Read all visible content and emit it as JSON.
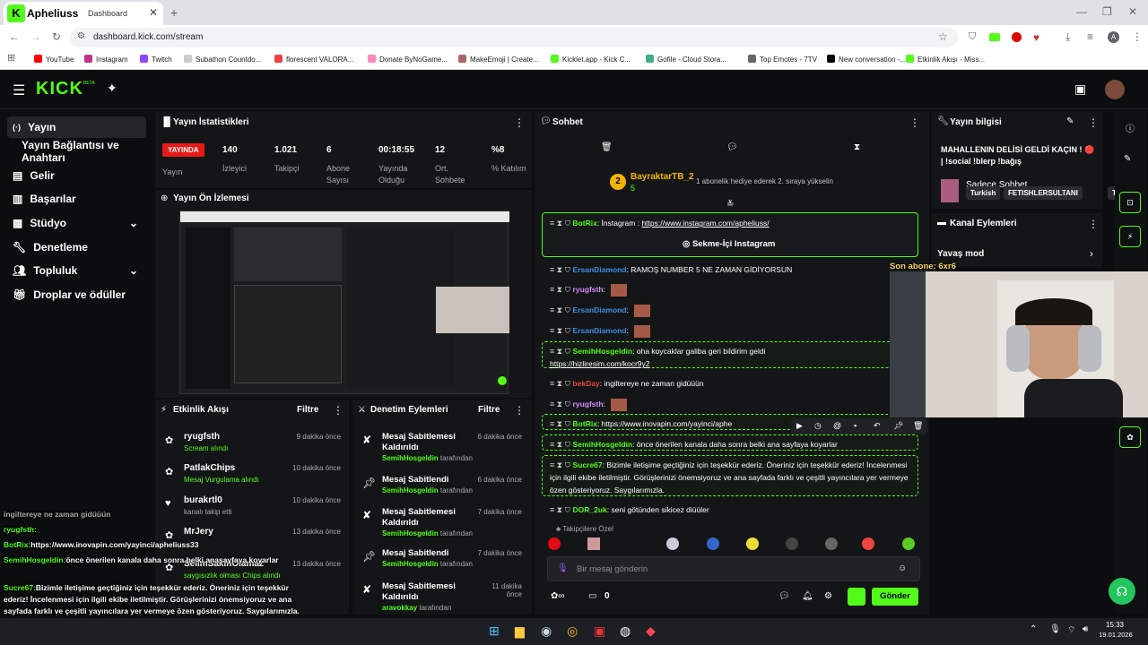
{
  "browser": {
    "tab_title": "Apheliuss",
    "tab_suffix": "Dashboard",
    "url": "dashboard.kick.com/stream",
    "bookmarks": [
      "YouTube",
      "Instagram",
      "Twitch",
      "Subathon Countdo...",
      "florescent VALORA...",
      "Donate ByNoGame...",
      "MakeEmoji | Create...",
      "Kicklet.app - Kick C...",
      "Gofile - Cloud Stora...",
      "Top Emotes - 7TV",
      "New conversation -...",
      "Etkinlik Akışı - Miss..."
    ]
  },
  "kick": {
    "logo": "KICK",
    "beta": "BETA"
  },
  "sidebar": {
    "items": [
      "Yayın",
      "Yayın Bağlantısı ve Anahtarı",
      "Gelir",
      "Başarılar",
      "Stüdyo",
      "Denetleme",
      "Topluluk",
      "Droplar ve ödüller"
    ]
  },
  "stats": {
    "title": "Yayın İstatistikleri",
    "live": "YAYINDA",
    "live_label": "Yayın",
    "cells": [
      {
        "v": "140",
        "l": "İzleyici"
      },
      {
        "v": "1.021",
        "l": "Takipçi"
      },
      {
        "v": "6",
        "l": "Abone Sayısı"
      },
      {
        "v": "00:18:55",
        "l": "Yayında Olduğu"
      },
      {
        "v": "12",
        "l": "Ort. Sohbete"
      },
      {
        "v": "%8",
        "l": "% Katılım"
      }
    ]
  },
  "preview": {
    "title": "Yayın Ön İzlemesi"
  },
  "events": {
    "title": "Etkinlik Akışı",
    "filter": "Filtre",
    "items": [
      {
        "n": "ryugfsth",
        "s": "Scream alındı",
        "t": "9 dakika önce"
      },
      {
        "n": "PatlakChips",
        "s": "Mesaj Vurgulama alındı",
        "t": "10 dakika önce"
      },
      {
        "n": "burakrtl0",
        "s": "kanalı takip etti",
        "t": "10 dakika önce"
      },
      {
        "n": "MrJery",
        "s": "",
        "t": "13 dakika önce"
      },
      {
        "n": "SelimSakinOlamaz",
        "s": "saygısızlık olması Chips alındı",
        "t": "13 dakika önce"
      }
    ]
  },
  "mod": {
    "title": "Denetim Eylemleri",
    "filter": "Filtre",
    "items": [
      {
        "a": "Mesaj Sabitlemesi Kaldırıldı",
        "b": "SemihHosgeldin",
        "t": "6 dakika önce"
      },
      {
        "a": "Mesaj Sabitlendi",
        "b": "SemihHosgeldin",
        "t": "6 dakika önce"
      },
      {
        "a": "Mesaj Sabitlemesi Kaldırıldı",
        "b": "SemihHosgeldin",
        "t": "7 dakika önce"
      },
      {
        "a": "Mesaj Sabitlendi",
        "b": "SemihHosgeldin",
        "t": "7 dakika önce"
      },
      {
        "a": "Mesaj Sabitlemesi Kaldırıldı",
        "b": "aravokkay",
        "t": "11 dakika önce"
      }
    ],
    "by": "tarafından"
  },
  "chat": {
    "title": "Sohbet",
    "gift_user": "BayraktarTB_2",
    "gift_count": "5",
    "gift_text": "1 abonelik hediye ederek 2. sıraya yükselin",
    "pinned_user": "BotRix",
    "pinned_text": "İnstagram : ",
    "pinned_link": "https://www.instagram.com/apheliuss/",
    "pinned_btn": "Sekme-İçi Instagram",
    "messages": [
      {
        "u": "ErsanDiamond",
        "c": "#3a8ee6",
        "t": "RAMOŞ NUMBER 5 NE ZAMAN GİDİYORSUN"
      },
      {
        "u": "ryugfsth",
        "c": "#d58cff",
        "t": ""
      },
      {
        "u": "ErsanDiamond",
        "c": "#3a8ee6",
        "t": ""
      },
      {
        "u": "ErsanDiamond",
        "c": "#3a8ee6",
        "t": ""
      },
      {
        "u": "SemihHosgeldin",
        "c": "#53fc18",
        "t": "oha koycaklar galiba geri bildirim geldi"
      },
      {
        "u": "bekDay",
        "c": "#e0453c",
        "t": "ingiltereye ne zaman gidüüün"
      },
      {
        "u": "ryugfsth",
        "c": "#d58cff",
        "t": ""
      },
      {
        "u": "BotRix",
        "c": "#53fc18",
        "t": "https://www.inovapin.com/yayinci/aphe"
      },
      {
        "u": "SemihHosgeldin",
        "c": "#53fc18",
        "t": "önce önerilen kanala daha sonra belki ana sayfaya koyarlar"
      },
      {
        "u": "Sucre67",
        "c": "#53fc18",
        "t": "Bizimle iletişime geçtiğiniz için teşekkür ederiz. Öneriniz için teşekkür ederiz! İncelenmesi için ilgili ekibe iletilmiştir. Görüşlerinizi önemsiyoruz ve ana sayfada farklı ve çeşitli yayıncılara yer vermeye özen gösteriyoruz. Saygılarımızla."
      },
      {
        "u": "DOR_2uk",
        "c": "#53fc18",
        "t": "seni götünden sikicez diüüler"
      }
    ],
    "link2": "https://hizliresim.com/kocr9y2",
    "followers_only": "Takipçilere Özel",
    "placeholder": "Bir mesaj gönderin",
    "count": "0",
    "send": "Gönder",
    "jump": "",
    "sub_overlay": "Son abone: 6xr6"
  },
  "info": {
    "title": "Yayın bilgisi",
    "stream_title": "MAHALLENIN DELİSİ GELDİ KAÇIN ! 🔴 | !social !blerp !bağış",
    "category": "Sadece Sohbet",
    "tags": [
      "Turkish",
      "FETISHLERSULTANI",
      "T"
    ]
  },
  "channel": {
    "title": "Kanal Eylemleri",
    "slow": "Yavaş mod"
  },
  "overlay_chat": [
    {
      "u": "",
      "t": "ingiltereye ne zaman gidüüün"
    },
    {
      "u": "ryugfsth:",
      "t": ""
    },
    {
      "u": "BotRix:",
      "t": "https://www.inovapin.com/yayinci/apheliuss33"
    },
    {
      "u": "SemihHosgeldin:",
      "t": "önce önerilen kanala daha sonra belki anasayfaya koyarlar"
    },
    {
      "u": "Sucre67:",
      "t": "Bizimle iletişime geçtiğiniz için teşekkür ederiz. Öneriniz için teşekkür ederiz! İncelenmesi için ilgili ekibe iletilmiştir. Görüşlerinizi önemsiyoruz ve ana sayfada farklı ve çeşitli yayıncılara yer vermeye özen gösteriyoruz. Saygılarımızla."
    },
    {
      "u": "DOR_2uk:",
      "t": "seni götünden sikicez diüüler"
    }
  ],
  "taskbar": {
    "time": "15:33",
    "date": "19.01.2026"
  },
  "colors": {
    "accent": "#53fc18",
    "live": "#e91916",
    "bg": "#0b0d0e",
    "panel": "#141517"
  }
}
